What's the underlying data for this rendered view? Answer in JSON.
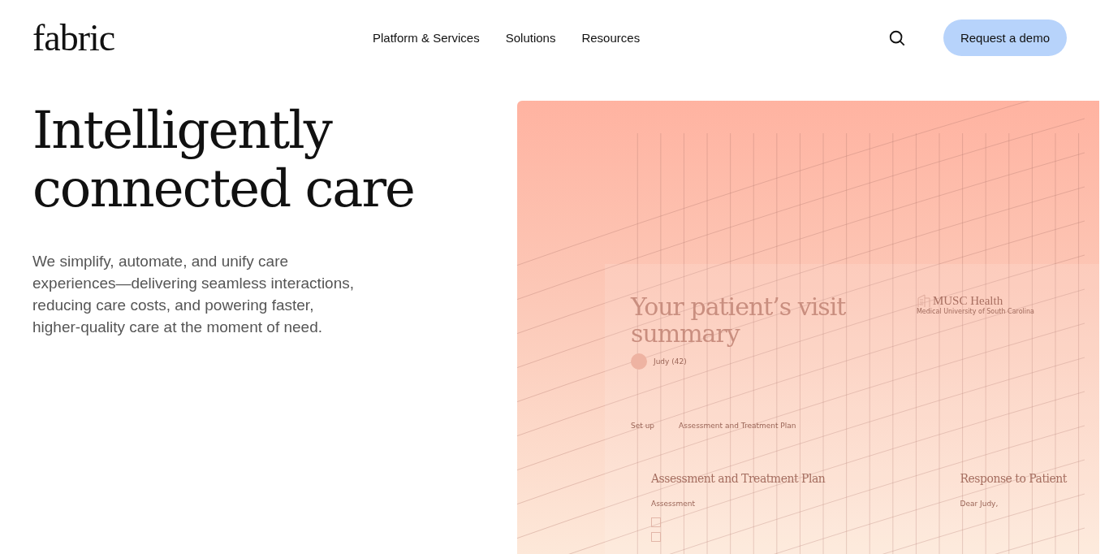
{
  "header": {
    "logo": "fabric",
    "nav": [
      {
        "label": "Platform & Services"
      },
      {
        "label": "Solutions"
      },
      {
        "label": "Resources"
      }
    ],
    "cta": "Request a demo"
  },
  "hero": {
    "headline_lines": [
      "Intelligently",
      "connected care"
    ],
    "body": "We simplify, automate, and unify care experiences—delivering seamless interactions, reducing care costs, and powering faster, higher-quality care at the moment of need."
  },
  "preview": {
    "title": "Your patient’s visit summary",
    "org_name": "MUSC Health",
    "org_subtitle": "Medical University of South Carolina",
    "patient": "Judy (42)",
    "steps": [
      {
        "label": "Set up"
      },
      {
        "label": "Assessment and Treatment Plan"
      }
    ],
    "plan_heading": "Assessment and Treatment Plan",
    "plan_label": "Assessment",
    "checklist": [
      {
        "checked": false
      },
      {
        "checked": false
      }
    ],
    "response_heading": "Response to Patient",
    "greeting": "Dear Judy,"
  }
}
